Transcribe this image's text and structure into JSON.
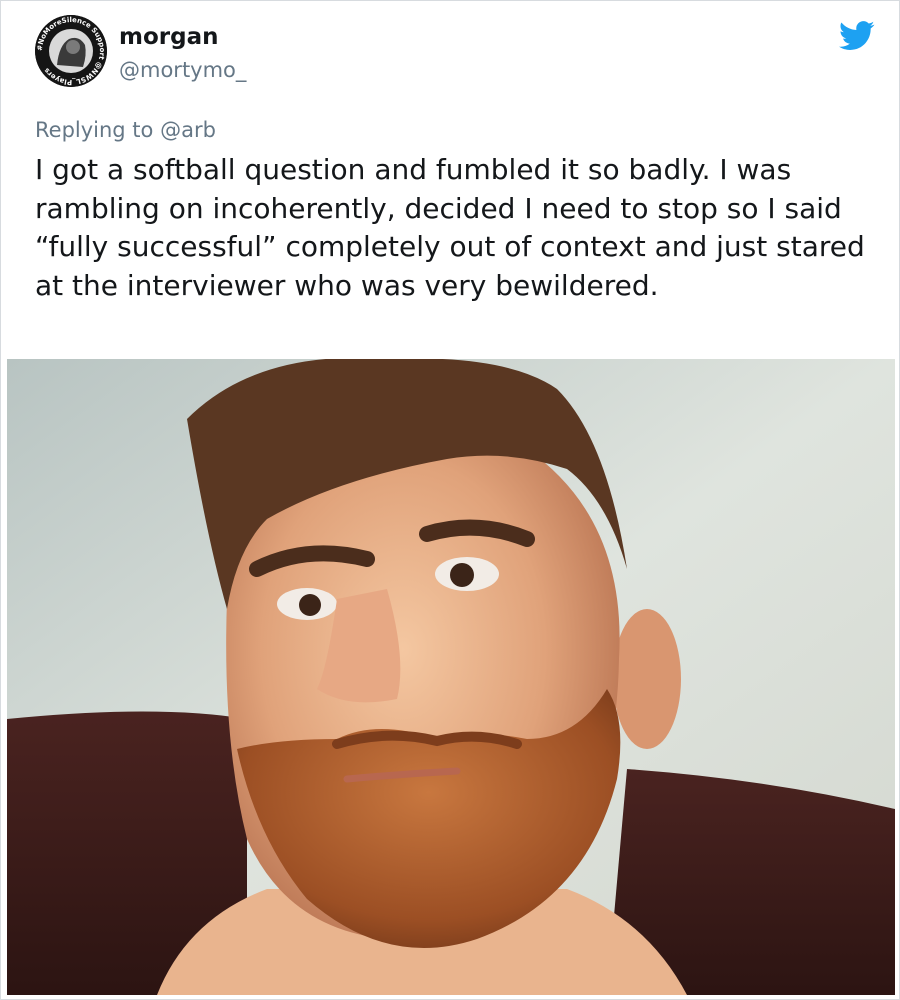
{
  "tweet": {
    "display_name": "morgan",
    "handle": "@mortymo_",
    "avatar_badge_text": "#NoMoreSilence Support @NWSL_Players",
    "reply_prefix": "Replying to ",
    "reply_to": "@arb",
    "body": "I got a softball question and fumbled it so badly. I was rambling on incoherently, decided I need to stop so I said “fully successful” completely out of context and just stared at the interviewer who was very bewildered.",
    "platform_icon": "twitter-bird-icon",
    "photo_description": "selfie-photo",
    "colors": {
      "brand": "#1da1f2",
      "text": "#14171a",
      "secondary_text": "#657786"
    }
  }
}
